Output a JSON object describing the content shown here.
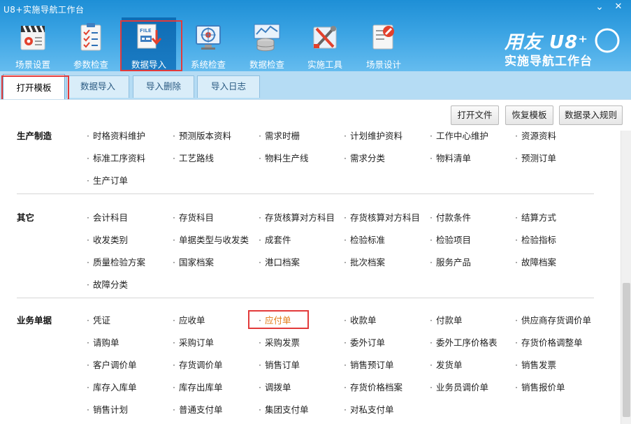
{
  "window": {
    "title": "U8+实施导航工作台",
    "minimize_glyph": "⌄",
    "close_glyph": "✕"
  },
  "toolbar": [
    {
      "label": "场景设置",
      "icon": "clapperboard-icon"
    },
    {
      "label": "参数检查",
      "icon": "checklist-icon"
    },
    {
      "label": "数据导入",
      "icon": "file-import-icon",
      "active": true
    },
    {
      "label": "系统检查",
      "icon": "monitor-target-icon"
    },
    {
      "label": "数据检查",
      "icon": "database-chart-icon"
    },
    {
      "label": "实施工具",
      "icon": "tools-icon"
    },
    {
      "label": "场景设计",
      "icon": "pencil-design-icon"
    }
  ],
  "logo": {
    "line1": "用友 U8⁺",
    "line2": "实施导航工作台"
  },
  "tabs": [
    {
      "label": "打开模板",
      "active": true
    },
    {
      "label": "数据导入"
    },
    {
      "label": "导入删除"
    },
    {
      "label": "导入日志"
    }
  ],
  "actions": {
    "open_file": "打开文件",
    "restore_template": "恢复模板",
    "rules": "数据录入规则"
  },
  "sections": [
    {
      "title": "生产制造",
      "rows": [
        [
          "时格资料维护",
          "预测版本资料",
          "需求时栅",
          "计划维护资料",
          "工作中心维护",
          "资源资料"
        ],
        [
          "标准工序资料",
          "工艺路线",
          "物料生产线",
          "需求分类",
          "物料清单",
          "预测订单"
        ],
        [
          "生产订单"
        ]
      ]
    },
    {
      "title": "其它",
      "rows": [
        [
          "会计科目",
          "存货科目",
          "存货核算对方科目",
          "存货核算对方科目",
          "付款条件",
          "结算方式"
        ],
        [
          "收发类别",
          "单据类型与收发类",
          "成套件",
          "检验标准",
          "检验项目",
          "检验指标"
        ],
        [
          "质量检验方案",
          "国家档案",
          "港口档案",
          "批次档案",
          "服务产品",
          "故障档案"
        ],
        [
          "故障分类"
        ]
      ]
    },
    {
      "title": "业务单据",
      "rows": [
        [
          "凭证",
          "应收单",
          "应付单",
          "收款单",
          "付款单",
          "供应商存货调价单"
        ],
        [
          "请购单",
          "采购订单",
          "采购发票",
          "委外订单",
          "委外工序价格表",
          "存货价格调整单"
        ],
        [
          "客户调价单",
          "存货调价单",
          "销售订单",
          "销售预订单",
          "发货单",
          "销售发票"
        ],
        [
          "库存入库单",
          "库存出库单",
          "调拨单",
          "存货价格档案",
          "业务员调价单",
          "销售报价单"
        ],
        [
          "销售计划",
          "普通支付单",
          "集团支付单",
          "对私支付单"
        ]
      ]
    }
  ],
  "highlight_item": "应付单",
  "bullet": "·",
  "colors": {
    "header_blue": "#1e8fd6",
    "tab_bar": "#b5dcf4",
    "highlight_red": "#e23a3a",
    "link_orange": "#e27a14"
  }
}
